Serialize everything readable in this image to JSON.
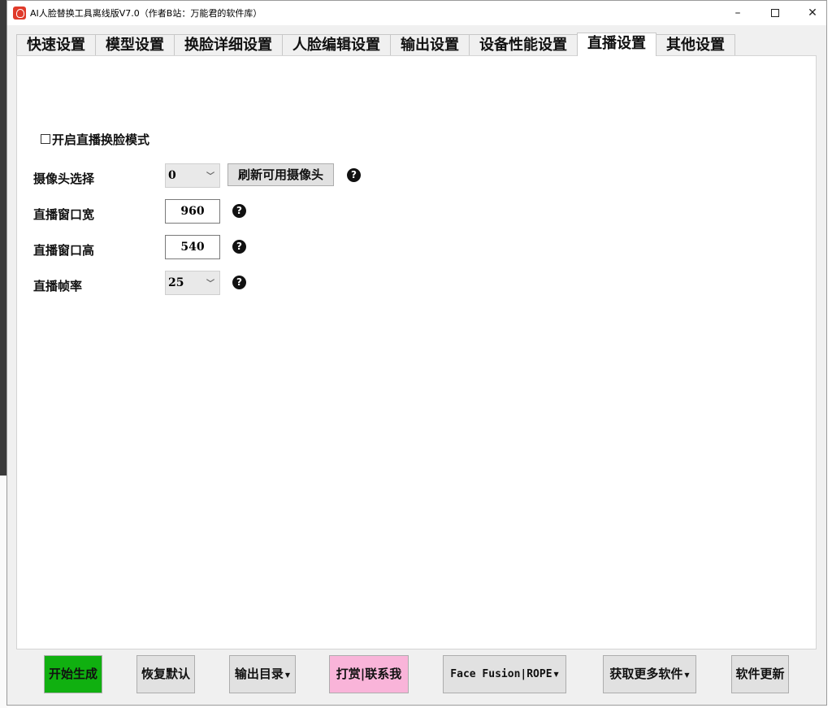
{
  "window": {
    "title": "AI人脸替换工具离线版V7.0（作者B站：万能君的软件库）",
    "controls": {
      "minimize": "–",
      "maximize": "□",
      "close": "✕"
    }
  },
  "tabs": [
    {
      "label": "快速设置",
      "active": false
    },
    {
      "label": "模型设置",
      "active": false
    },
    {
      "label": "换脸详细设置",
      "active": false
    },
    {
      "label": "人脸编辑设置",
      "active": false
    },
    {
      "label": "输出设置",
      "active": false
    },
    {
      "label": "设备性能设置",
      "active": false
    },
    {
      "label": "直播设置",
      "active": true
    },
    {
      "label": "其他设置",
      "active": false
    }
  ],
  "live": {
    "enable_label": "开启直播换脸模式",
    "enable_checked": false,
    "camera_label": "摄像头选择",
    "camera_value": "0",
    "refresh_button": "刷新可用摄像头",
    "width_label": "直播窗口宽",
    "width_value": "960",
    "height_label": "直播窗口高",
    "height_value": "540",
    "fps_label": "直播帧率",
    "fps_value": "25",
    "help_glyph": "?"
  },
  "bottom_buttons": {
    "start": "开始生成",
    "reset": "恢复默认",
    "output_dir": "输出目录",
    "donate": "打赏|联系我",
    "face_fusion": "Face Fusion|ROPE",
    "more_software": "获取更多软件",
    "update": "软件更新"
  },
  "colors": {
    "start_button": "#10b010",
    "donate_button": "#f9b4d9",
    "default_button": "#e1e1e1"
  }
}
